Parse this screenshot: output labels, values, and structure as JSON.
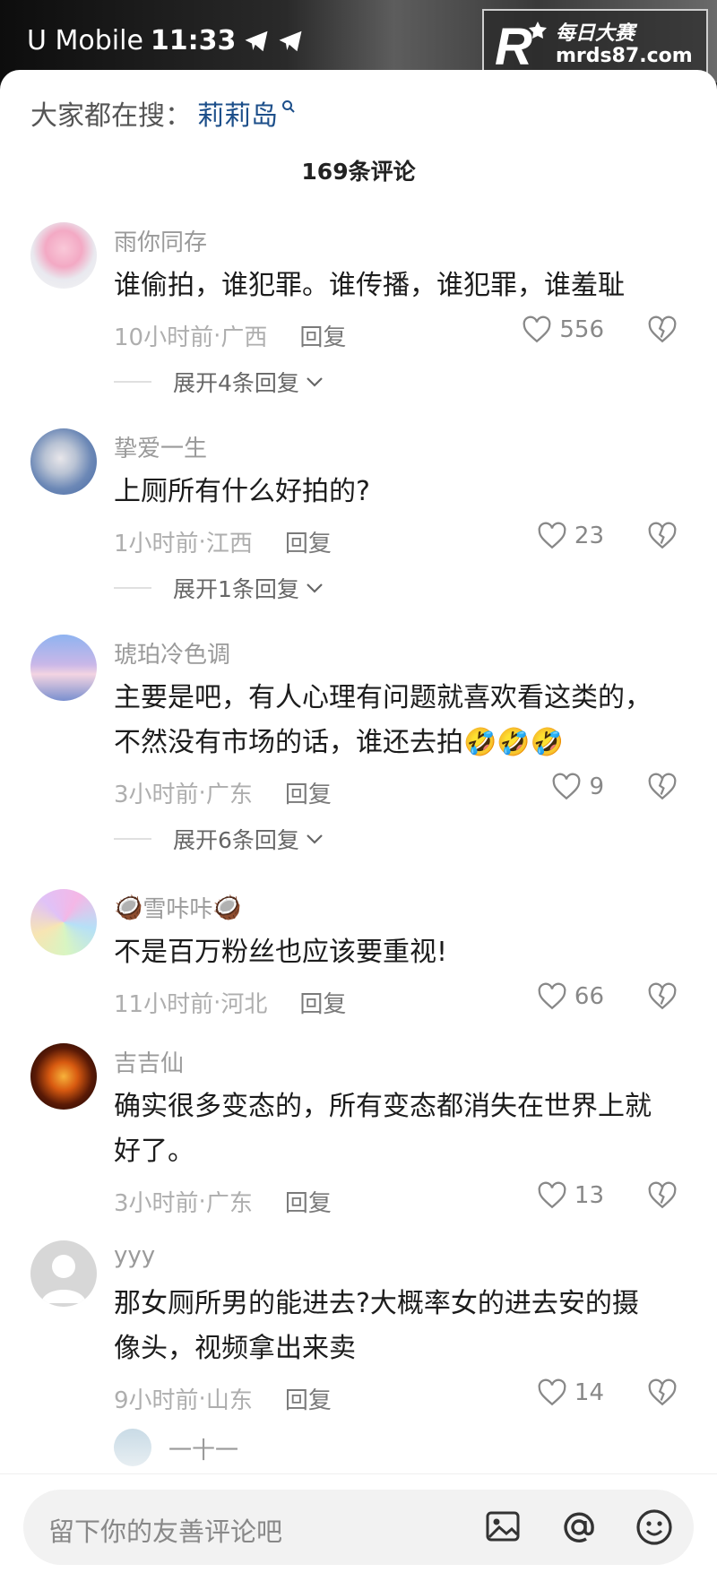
{
  "status_bar": {
    "carrier": "U Mobile",
    "time": "11:33"
  },
  "watermark": {
    "line1": "每日大赛",
    "line2": "mrds87.com",
    "logo_letter": "R"
  },
  "hot_search": {
    "label": "大家都在搜：",
    "keyword": "莉莉岛"
  },
  "comments_header": {
    "title": "169条评论"
  },
  "comments": [
    {
      "user": "雨你同存",
      "text": "谁偷拍，谁犯罪。谁传播，谁犯罪，谁羞耻",
      "time": "10小时前",
      "location": "广西",
      "reply_label": "回复",
      "likes": "556",
      "expand": "展开4条回复"
    },
    {
      "user": "挚爱一生",
      "text": "上厕所有什么好拍的?",
      "time": "1小时前",
      "location": "江西",
      "reply_label": "回复",
      "likes": "23",
      "expand": "展开1条回复"
    },
    {
      "user": "琥珀冷色调",
      "text_line1": "主要是吧，有人心理有问题就喜欢看这类的，",
      "text_line2": "不然没有市场的话，谁还去拍",
      "emoji": "🤣🤣🤣",
      "time": "3小时前",
      "location": "广东",
      "reply_label": "回复",
      "likes": "9",
      "expand": "展开6条回复"
    },
    {
      "user": "雪咔咔",
      "user_emoji": "🥥",
      "text": "不是百万粉丝也应该要重视!",
      "time": "11小时前",
      "location": "河北",
      "reply_label": "回复",
      "likes": "66"
    },
    {
      "user": "吉吉仙",
      "text_line1": "确实很多变态的，所有变态都消失在世界上就",
      "text_line2": "好了。",
      "time": "3小时前",
      "location": "广东",
      "reply_label": "回复",
      "likes": "13"
    },
    {
      "user": "yyy",
      "text_line1": "那女厕所男的能进去?大概率女的进去安的摄",
      "text_line2": "像头，视频拿出来卖",
      "time": "9小时前",
      "location": "山东",
      "reply_label": "回复",
      "likes": "14"
    },
    {
      "user": "一十一"
    }
  ],
  "meta_separator": " · ",
  "input_bar": {
    "placeholder": "留下你的友善评论吧"
  },
  "icons": {
    "heart": "heart-icon",
    "dislike": "broken-heart-icon",
    "chevron": "chevron-down-icon",
    "image": "image-icon",
    "at": "at-icon",
    "emoji": "emoji-icon",
    "search": "search-icon",
    "telegram": "telegram-icon"
  },
  "colors": {
    "keyword_blue": "#1d4f8a",
    "meta_gray": "#aeaeae",
    "text_dark": "#1c1c1c"
  }
}
